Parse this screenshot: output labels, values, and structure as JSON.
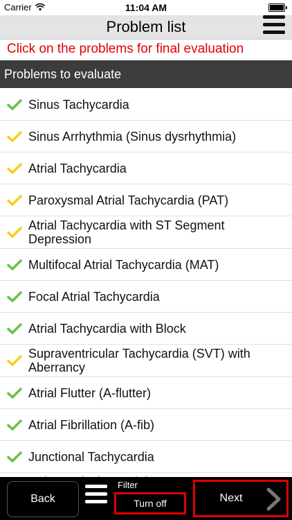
{
  "status_bar": {
    "carrier": "Carrier",
    "time": "11:04 AM",
    "battery_level": 1.0
  },
  "nav": {
    "title": "Problem list",
    "menu_icon": "hamburger-menu-icon"
  },
  "hint": "Click on the problems for final evaluation",
  "section_header": "Problems to evaluate",
  "colors": {
    "check_green": "#6cc04a",
    "check_yellow": "#f5cf1d",
    "alert_red": "#e00000"
  },
  "problems": [
    {
      "label": "Sinus Tachycardia",
      "status": "green"
    },
    {
      "label": "Sinus Arrhythmia (Sinus dysrhythmia)",
      "status": "yellow"
    },
    {
      "label": "Atrial Tachycardia",
      "status": "yellow"
    },
    {
      "label": "Paroxysmal Atrial Tachycardia (PAT)",
      "status": "yellow"
    },
    {
      "label": "Atrial Tachycardia with ST Segment Depression",
      "status": "yellow"
    },
    {
      "label": "Multifocal Atrial Tachycardia (MAT)",
      "status": "green"
    },
    {
      "label": "Focal Atrial Tachycardia",
      "status": "green"
    },
    {
      "label": "Atrial Tachycardia with Block",
      "status": "green"
    },
    {
      "label": "Supraventricular Tachycardia (SVT) with Aberrancy",
      "status": "yellow"
    },
    {
      "label": "Atrial Flutter (A-flutter)",
      "status": "green"
    },
    {
      "label": "Atrial Fibrillation (A-fib)",
      "status": "green"
    },
    {
      "label": "Junctional Tachycardia",
      "status": "green"
    },
    {
      "label": "Atrioventricular Nodal Reentry Tachycardia",
      "status": "green"
    }
  ],
  "toolbar": {
    "back_label": "Back",
    "filter_label": "Filter",
    "turn_off_label": "Turn off",
    "next_label": "Next"
  }
}
